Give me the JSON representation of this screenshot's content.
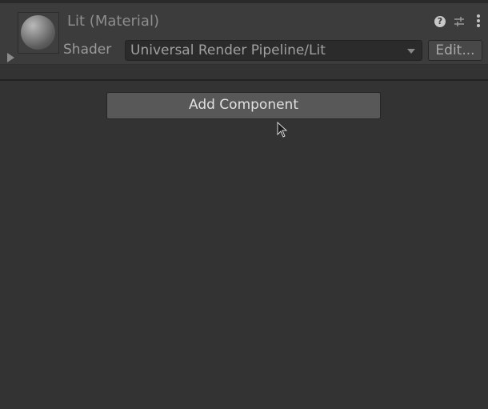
{
  "material": {
    "title": "Lit (Material)",
    "shader_label": "Shader",
    "shader_value": "Universal Render Pipeline/Lit",
    "edit_label": "Edit...",
    "help_glyph": "?"
  },
  "inspector": {
    "add_component_label": "Add Component"
  },
  "icons": {
    "preview": "material-sphere-preview",
    "foldout": "foldout-arrow-icon",
    "help": "help-icon",
    "presets": "presets-icon",
    "menu": "kebab-menu-icon",
    "cursor": "mouse-cursor-icon"
  },
  "colors": {
    "background": "#333333",
    "header": "#3c3c3c",
    "button": "#585858"
  }
}
